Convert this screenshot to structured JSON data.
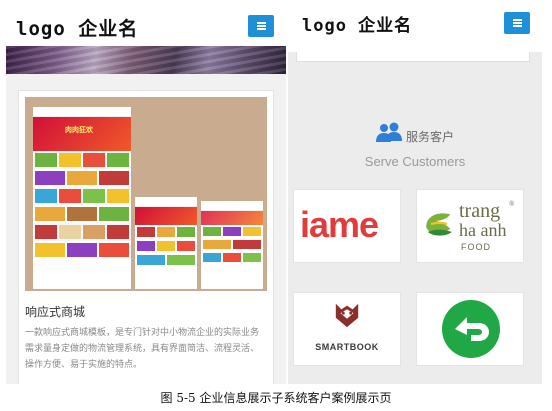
{
  "left_screen": {
    "header": {
      "logo": "logo 企业名"
    },
    "case_card": {
      "title": "响应式商城",
      "description": "一款响应式商城模板，是专门针对中小物流企业的实际业务需求量身定做的物流管理系统，具有界面简洁、流程灵活、操作方便、易于实施的特点。",
      "mock_site_text": {
        "hero_banner": "肉肉狂欢"
      }
    }
  },
  "right_screen": {
    "header": {
      "logo": "logo 企业名"
    },
    "services": {
      "icon": "users-icon",
      "title": "服务客户",
      "subtitle": "Serve Customers"
    },
    "customer_logos": [
      {
        "name": "iame",
        "text": "iame",
        "color": "#e13b3b"
      },
      {
        "name": "trang-ha-anh",
        "line1": "trang",
        "line2": "ha anh",
        "line3": "FOOD",
        "mark": "®"
      },
      {
        "name": "smartbook",
        "text": "SMARTBOOK"
      },
      {
        "name": "green-brand",
        "color": "#1fa845"
      }
    ]
  },
  "caption": "图 5-5 企业信息展示子系统客户案例展示页",
  "colors": {
    "accent": "#1f8fd8",
    "background": "#ececec",
    "brand_red": "#e13b3b",
    "brand_green": "#1fa845"
  }
}
